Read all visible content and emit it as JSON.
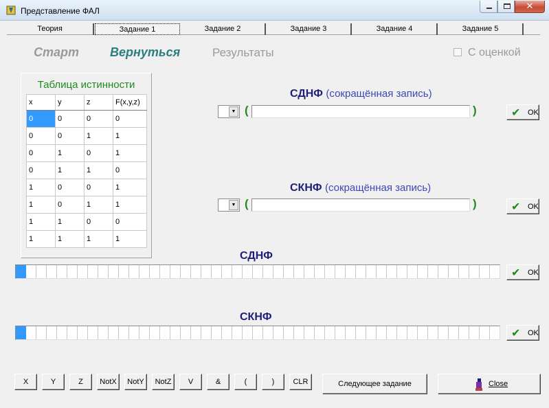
{
  "window": {
    "title": "Представление ФАЛ"
  },
  "tabs": [
    {
      "label": "Теория"
    },
    {
      "label": "Задание 1"
    },
    {
      "label": "Задание 2"
    },
    {
      "label": "Задание 3"
    },
    {
      "label": "Задание 4"
    },
    {
      "label": "Задание 5"
    }
  ],
  "actions": {
    "start": "Старт",
    "back": "Вернуться",
    "results": "Результаты",
    "grade_label": "С оценкой",
    "grade_checked": false
  },
  "truth_table": {
    "title": "Таблица истинности",
    "headers": [
      "x",
      "y",
      "z",
      "F(x,y,z)"
    ],
    "rows": [
      [
        "0",
        "0",
        "0",
        "0"
      ],
      [
        "0",
        "0",
        "1",
        "1"
      ],
      [
        "0",
        "1",
        "0",
        "1"
      ],
      [
        "0",
        "1",
        "1",
        "0"
      ],
      [
        "1",
        "0",
        "0",
        "1"
      ],
      [
        "1",
        "0",
        "1",
        "1"
      ],
      [
        "1",
        "1",
        "0",
        "0"
      ],
      [
        "1",
        "1",
        "1",
        "1"
      ]
    ]
  },
  "sdnf_short": {
    "title": "СДНФ",
    "subtitle": "(сокращённая запись)",
    "value": "",
    "ok": "OK"
  },
  "sknf_short": {
    "title": "СКНФ",
    "subtitle": "(сокращённая запись)",
    "value": "",
    "ok": "OK"
  },
  "sdnf_full": {
    "title": "СДНФ",
    "ok": "OK"
  },
  "sknf_full": {
    "title": "СКНФ",
    "ok": "OK"
  },
  "keypad": [
    "X",
    "Y",
    "Z",
    "NotX",
    "NotY",
    "NotZ",
    "V",
    "&",
    "(",
    ")",
    "CLR"
  ],
  "next_task": "Следующее задание",
  "close": "Close",
  "colors": {
    "accent_green": "#1f8a1f",
    "heading_blue": "#1e1e78",
    "selection": "#3399ff",
    "back_link": "#2f7d7d"
  }
}
